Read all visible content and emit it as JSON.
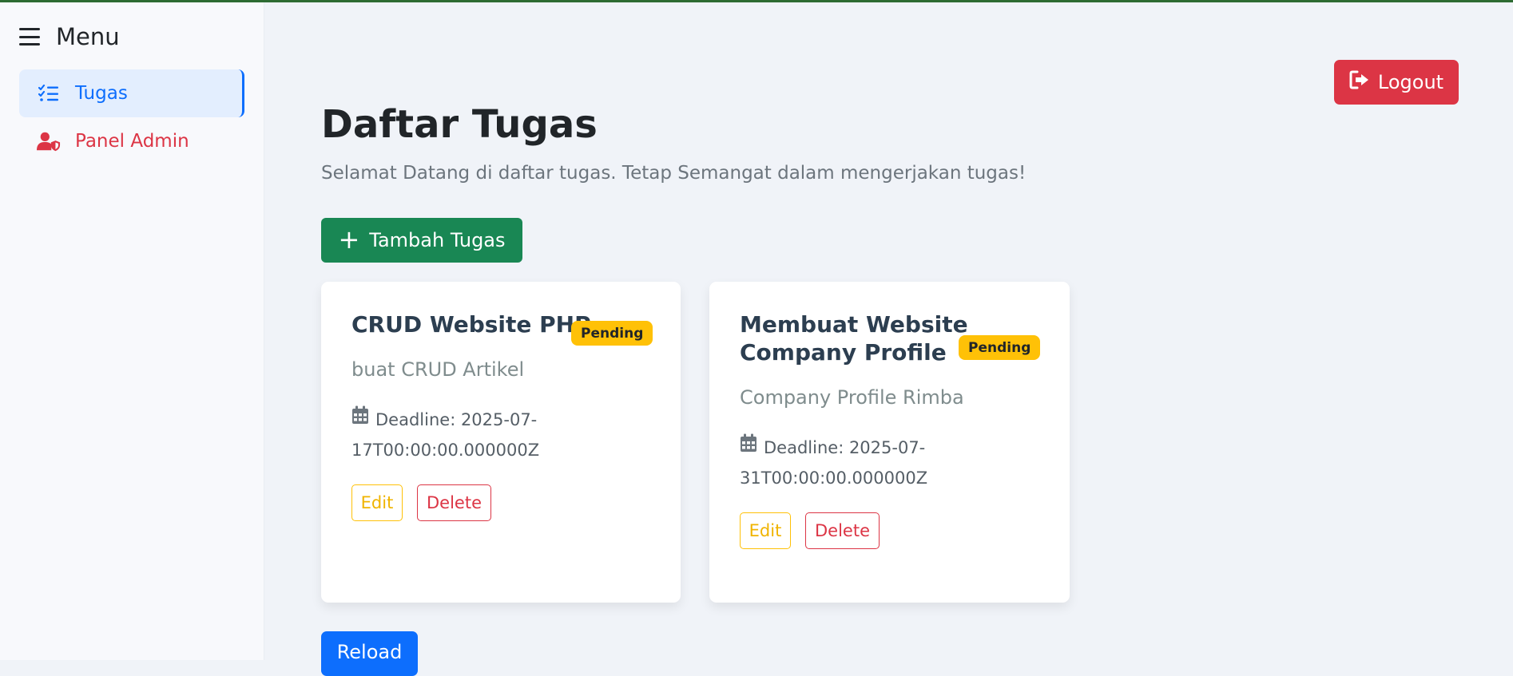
{
  "sidebar": {
    "title": "Menu",
    "items": [
      {
        "label": "Tugas",
        "icon": "list-check-icon"
      },
      {
        "label": "Panel Admin",
        "icon": "user-shield-icon"
      }
    ]
  },
  "header": {
    "logout_label": "Logout",
    "title": "Daftar Tugas",
    "subtitle": "Selamat Datang di daftar tugas. Tetap Semangat dalam mengerjakan tugas!"
  },
  "actions": {
    "add_label": "Tambah Tugas",
    "reload_label": "Reload"
  },
  "tasks": [
    {
      "title_lines": [
        "CRUD Website PHP"
      ],
      "status": "Pending",
      "description": "buat CRUD Artikel",
      "deadline_lines": [
        "Deadline: 2025-07-",
        "17T00:00:00.000000Z"
      ],
      "edit_label": "Edit",
      "delete_label": "Delete"
    },
    {
      "title_lines": [
        "Membuat Website",
        "Company Profile"
      ],
      "status": "Pending",
      "description": "Company Profile Rimba",
      "deadline_lines": [
        "Deadline: 2025-07-",
        "31T00:00:00.000000Z"
      ],
      "edit_label": "Edit",
      "delete_label": "Delete"
    }
  ],
  "colors": {
    "accent": "#0d6efd",
    "danger": "#dc3545",
    "success": "#198754",
    "warning": "#ffc107"
  }
}
